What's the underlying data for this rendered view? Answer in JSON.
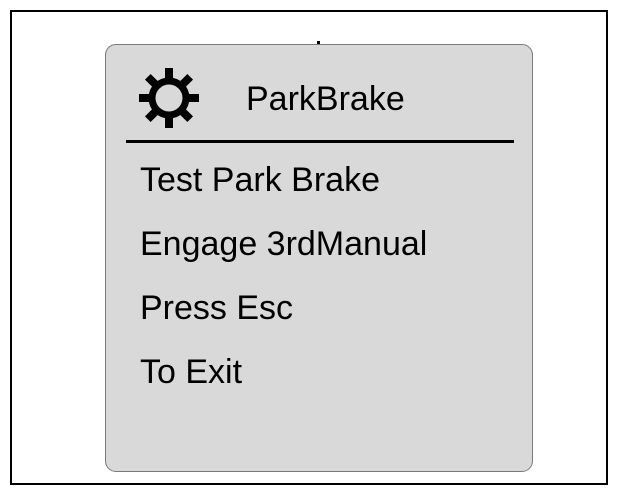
{
  "screen": {
    "title": "ParkBrake",
    "title_icon": "gear-icon",
    "lines": [
      "Test Park Brake",
      "Engage 3rdManual",
      "Press Esc",
      "To Exit"
    ]
  },
  "colors": {
    "panel_background": "#d9d9d9",
    "panel_border": "#7a7a7a",
    "text": "#000000",
    "page_background": "#ffffff"
  }
}
